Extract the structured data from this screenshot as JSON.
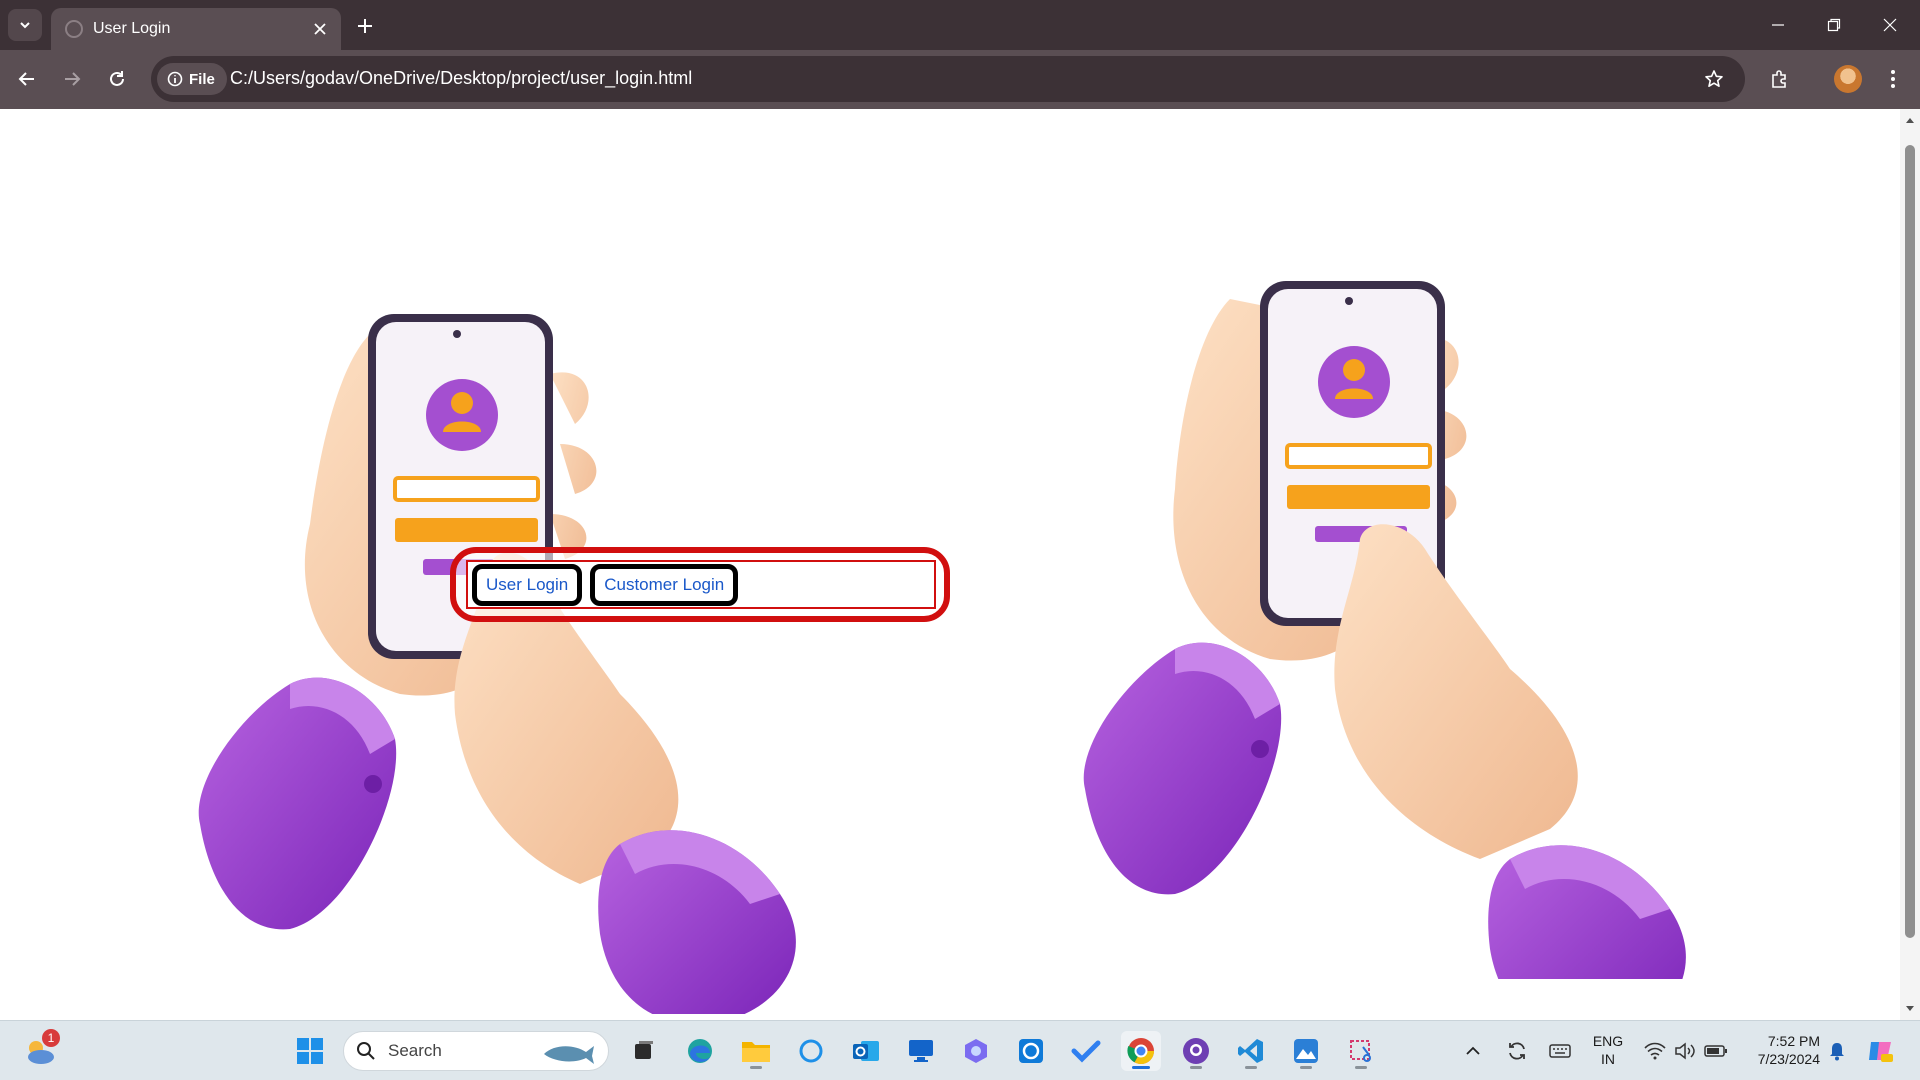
{
  "browser": {
    "tab": {
      "title": "User Login"
    },
    "address_bar": {
      "chip_label": "File",
      "url": "C:/Users/godav/OneDrive/Desktop/project/user_login.html"
    }
  },
  "page": {
    "nav": {
      "links": [
        {
          "label": "User Login"
        },
        {
          "label": "Customer Login"
        }
      ]
    },
    "illustrations": [
      {
        "name": "hands-holding-phone-login-illustration",
        "icon": "phone-login-icon"
      },
      {
        "name": "hands-holding-phone-login-illustration",
        "icon": "phone-login-icon"
      }
    ]
  },
  "taskbar": {
    "weather_badge": "1",
    "search_placeholder": "Search",
    "tray": {
      "language_line1": "ENG",
      "language_line2": "IN",
      "time": "7:52 PM",
      "date": "7/23/2024"
    }
  }
}
